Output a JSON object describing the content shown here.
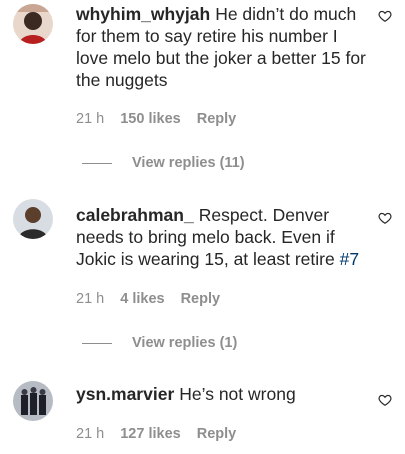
{
  "comments": [
    {
      "username": "whyhim_whyjah",
      "text": "He didn’t do much for them to say retire his number I love melo but the joker a better 15 for the nuggets",
      "time": "21 h",
      "likes": "150 likes",
      "reply": "Reply",
      "view_replies": "View replies (11)"
    },
    {
      "username": "calebrahman_",
      "text": "Respect. Denver needs to bring melo back. Even if Jokic is wearing 15, at least retire ",
      "hashtag": "#7",
      "time": "21 h",
      "likes": "4 likes",
      "reply": "Reply",
      "view_replies": "View replies (1)"
    },
    {
      "username": "ysn.marvier",
      "text": "He’s not wrong",
      "time": "21 h",
      "likes": "127 likes",
      "reply": "Reply"
    }
  ],
  "colors": {
    "text": "#262626",
    "meta": "#8e8e8e",
    "hashtag": "#00376b"
  }
}
